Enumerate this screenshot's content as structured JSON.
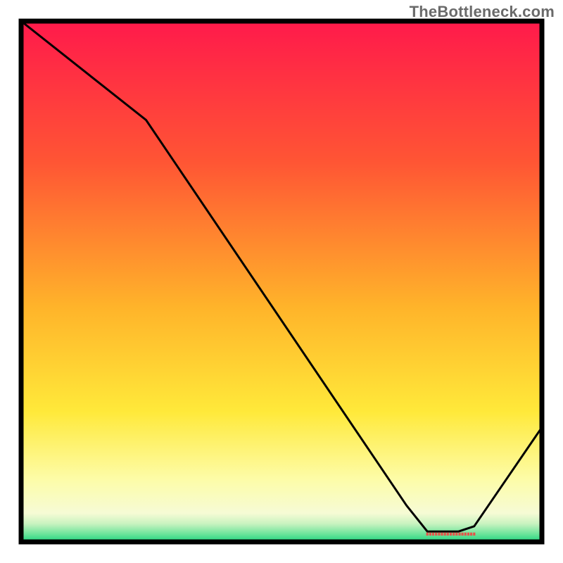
{
  "watermark": "TheBottleneck.com",
  "chart_data": {
    "type": "line",
    "title": "",
    "xlabel": "",
    "ylabel": "",
    "xlim": [
      0,
      100
    ],
    "ylim": [
      0,
      100
    ],
    "x": [
      0,
      24,
      74,
      78,
      84,
      87,
      100
    ],
    "values": [
      100,
      81,
      7,
      2,
      2,
      3,
      22
    ],
    "marker_segment": {
      "x_start": 78,
      "x_end": 87,
      "y": 1.5
    },
    "gradient_stops": [
      {
        "offset": 0.0,
        "color": "#ff1a4b"
      },
      {
        "offset": 0.27,
        "color": "#ff5534"
      },
      {
        "offset": 0.55,
        "color": "#ffb42a"
      },
      {
        "offset": 0.75,
        "color": "#ffe93a"
      },
      {
        "offset": 0.88,
        "color": "#fdfca8"
      },
      {
        "offset": 0.945,
        "color": "#f6fbd5"
      },
      {
        "offset": 0.965,
        "color": "#c9f3c0"
      },
      {
        "offset": 0.985,
        "color": "#6be49a"
      },
      {
        "offset": 1.0,
        "color": "#1fd37e"
      }
    ]
  }
}
